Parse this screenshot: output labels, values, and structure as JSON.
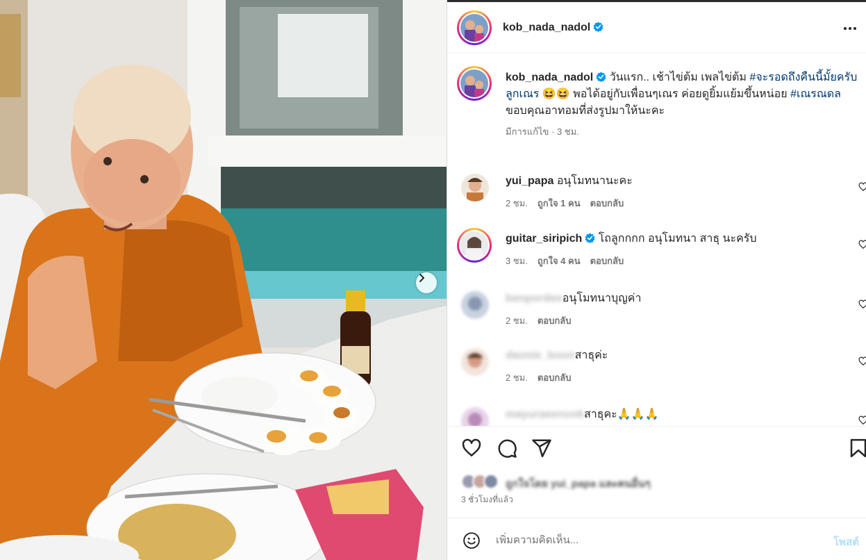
{
  "post_author": {
    "username": "kob_nada_nadol",
    "verified": true
  },
  "caption": {
    "username": "kob_nada_nadol",
    "text_1": " วันแรก.. เช้าไข่ต้ม เพลไข่ต้ม ",
    "hashtag_1": "#จะรอดถึงคืนนี้มั้ยครับลูกเณร",
    "text_2": " 😆😆 พอได้อยู่กับเพื่อนๆเณร ค่อยดูยิ้มแย้มขึ้นหน่อย ",
    "hashtag_2": "#เณรณดล",
    "line_2": "ขอบคุณอาทอมที่ส่งรูปมาให้นะคะ",
    "edited": "มีการแก้ไข",
    "time": "3 ชม."
  },
  "comments": [
    {
      "username": "yui_papa",
      "text": "อนุโมทนานะคะ",
      "time": "2 ชม.",
      "likes": "ถูกใจ 1 คน",
      "reply": "ตอบกลับ",
      "verified": false
    },
    {
      "username": "guitar_siripich",
      "text": "โถลูกกกก อนุโมทนา สาธุ นะครับ",
      "time": "3 ชม.",
      "likes": "ถูกใจ 4 คน",
      "reply": "ตอบกลับ",
      "verified": true
    },
    {
      "username": "benpordee",
      "text": "อนุโมทนาบุญค่า",
      "time": "2 ชม.",
      "reply": "ตอบกลับ",
      "blurred": true
    },
    {
      "username": "daonie_boon",
      "text": "สาธุค่ะ",
      "time": "2 ชม.",
      "reply": "ตอบกลับ",
      "blurred": true
    },
    {
      "username": "mayuraeenook",
      "text": "สาธุคะ🙏🙏🙏",
      "blurred": true
    }
  ],
  "likes_summary": "ถูกใจโดย yui_papa และคนอื่นๆ",
  "time_ago": "3 ชั่วโมงที่แล้ว",
  "add_comment": {
    "placeholder": "เพิ่มความคิดเห็น...",
    "post_label": "โพสต์"
  },
  "icons": {
    "like": "heart-icon",
    "comment": "comment-icon",
    "share": "share-icon",
    "save": "bookmark-icon",
    "emoji": "emoji-icon",
    "more": "more-options-icon",
    "next": "chevron-right-icon"
  },
  "colors": {
    "hashtag": "#00376b",
    "verified": "#0095f6",
    "post_button": "#b2dffc",
    "secondary_text": "#737373",
    "robe": "#d9741b"
  }
}
